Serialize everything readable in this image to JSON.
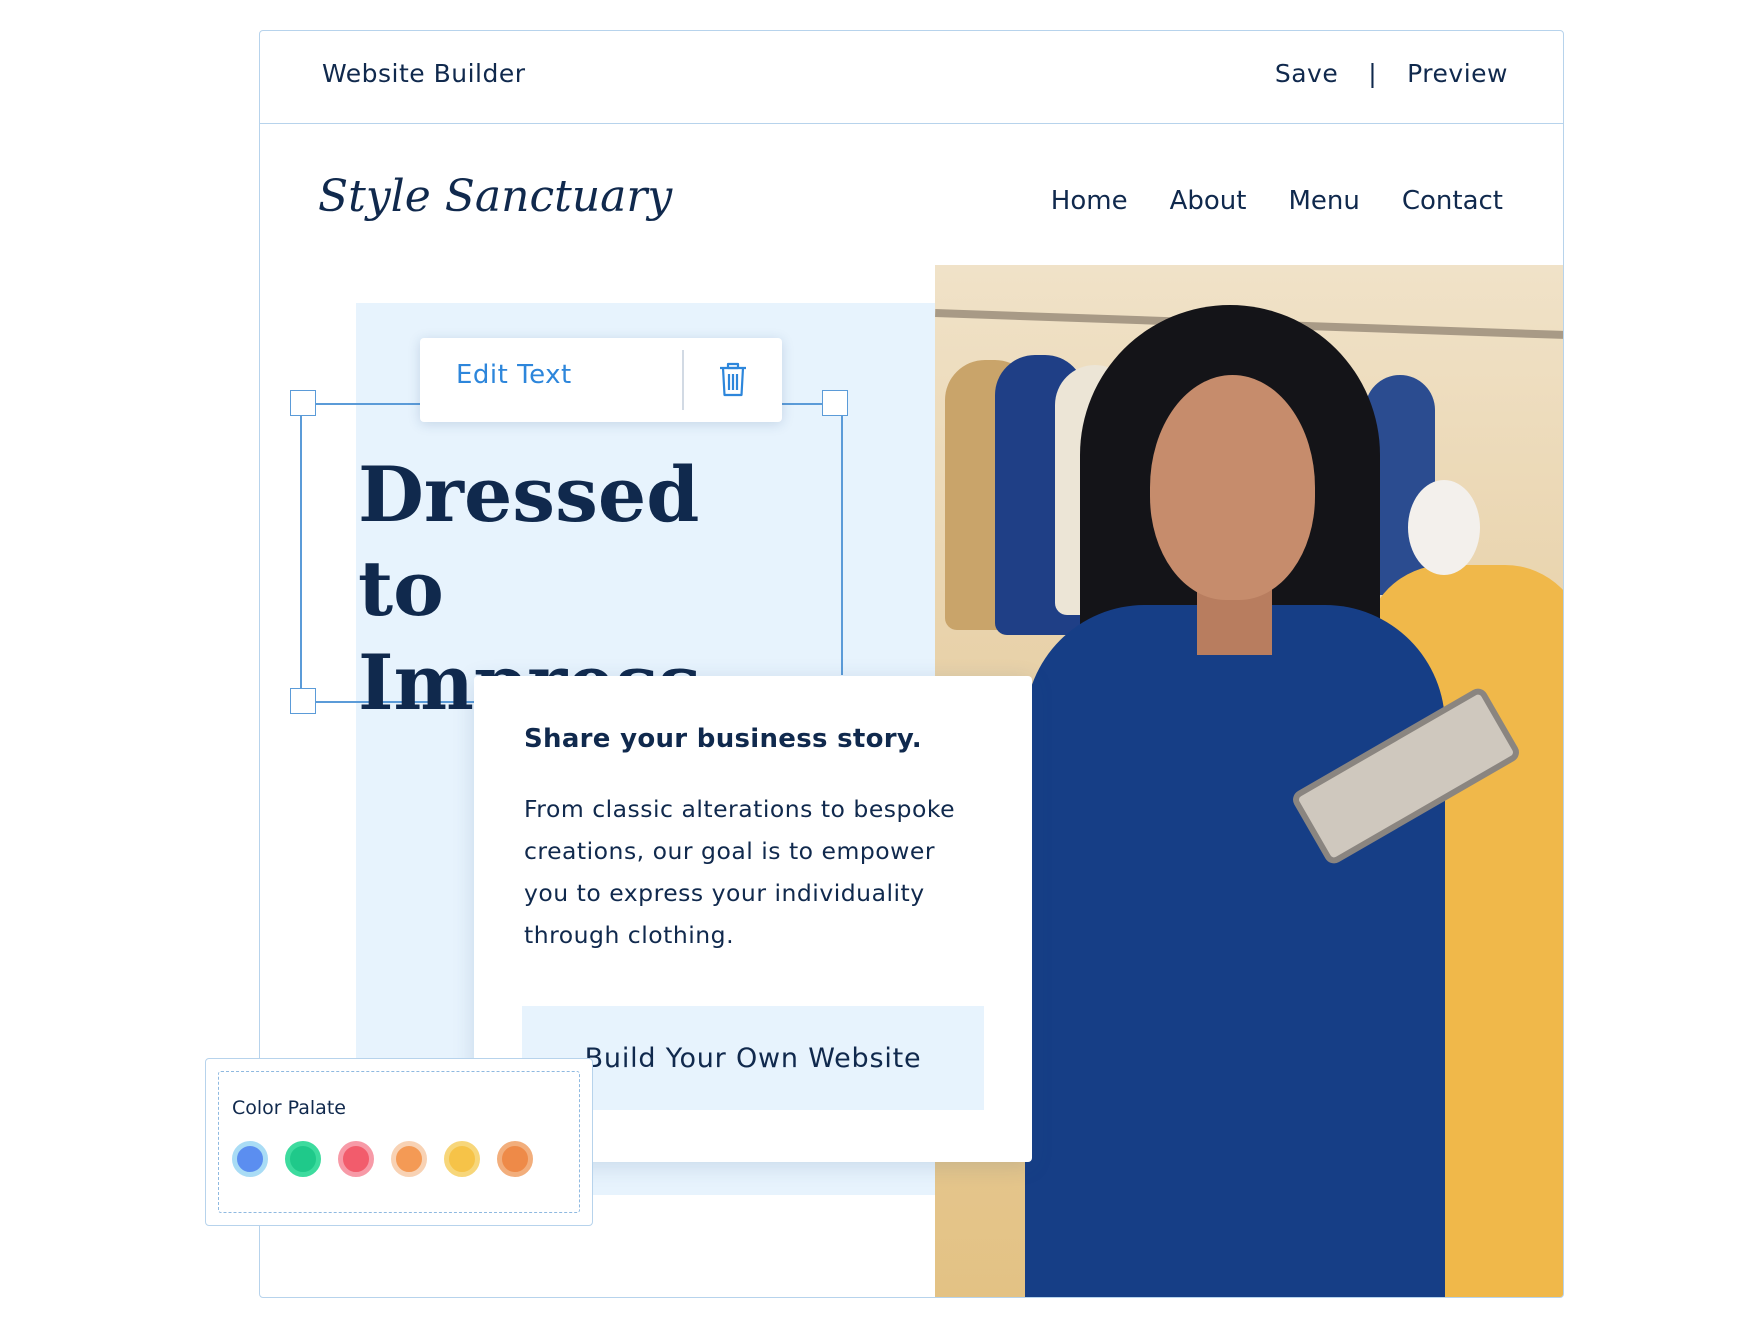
{
  "app": {
    "title": "Website Builder",
    "save_label": "Save",
    "separator": "|",
    "preview_label": "Preview"
  },
  "site": {
    "logo": "Style Sanctuary",
    "nav": [
      "Home",
      "About",
      "Menu",
      "Contact"
    ]
  },
  "editor": {
    "edit_text_label": "Edit Text",
    "delete_icon": "trash-icon"
  },
  "hero": {
    "headline_line1": "Dressed to",
    "headline_line2": "Impress",
    "card_title": "Share your business story.",
    "card_body": "From classic alterations to bespoke creations, our goal is to empower you to express your individuality through clothing.",
    "cta_label": "Build Your Own Website"
  },
  "palette": {
    "title": "Color Palate",
    "colors": [
      {
        "fill": "#5b8ef0",
        "ring": "#a9dcf5"
      },
      {
        "fill": "#1fc98a",
        "ring": "#3ddb9e"
      },
      {
        "fill": "#f25c6c",
        "ring": "#f79aa7"
      },
      {
        "fill": "#f49a55",
        "ring": "#f8d2b4"
      },
      {
        "fill": "#f6c348",
        "ring": "#f7d67a"
      },
      {
        "fill": "#ee8a48",
        "ring": "#f2ae7c"
      }
    ]
  }
}
